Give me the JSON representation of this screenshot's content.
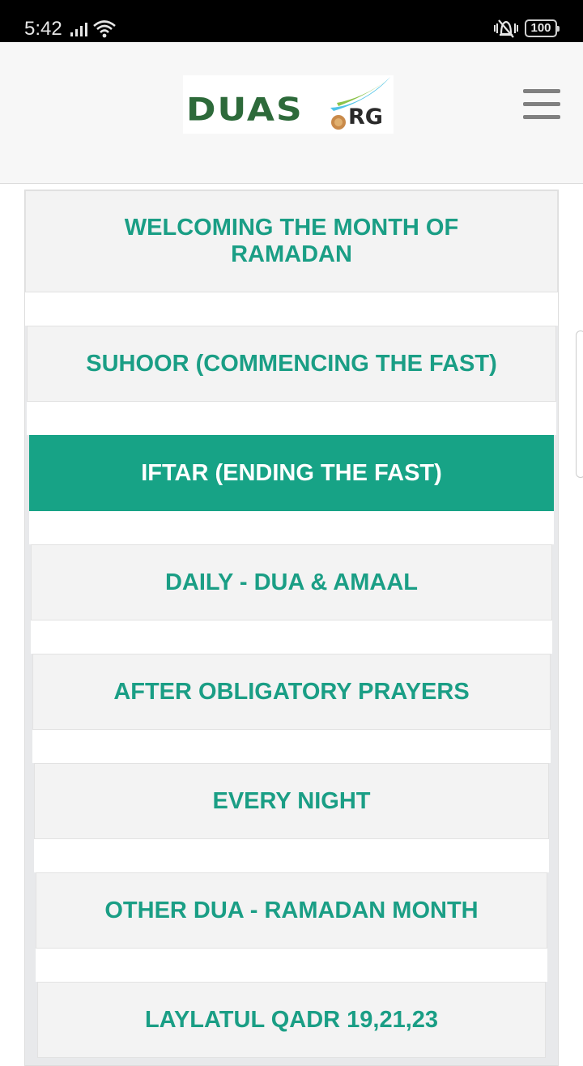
{
  "status_bar": {
    "time": "5:42",
    "battery": "100",
    "icons": [
      "signal-icon",
      "wifi-icon",
      "vibrate-icon",
      "battery-icon"
    ]
  },
  "header": {
    "logo_text": "DUAS",
    "logo_suffix": "RG",
    "menu_icon": "hamburger-menu-icon"
  },
  "menu": {
    "items": [
      {
        "label": "WELCOMING THE MONTH OF RAMADAN",
        "active": false
      },
      {
        "label": "SUHOOR (COMMENCING THE FAST)",
        "active": false
      },
      {
        "label": "IFTAR (ENDING THE FAST)",
        "active": true
      },
      {
        "label": "DAILY - DUA & AMAAL",
        "active": false
      },
      {
        "label": "AFTER OBLIGATORY PRAYERS",
        "active": false
      },
      {
        "label": "EVERY NIGHT",
        "active": false
      },
      {
        "label": "OTHER DUA - RAMADAN MONTH",
        "active": false
      },
      {
        "label": "LAYLATUL QADR 19,21,23",
        "active": false
      }
    ]
  },
  "colors": {
    "accent": "#17a386",
    "item_text": "#1a9e85",
    "item_bg": "#f3f3f3",
    "header_bg": "#f7f7f7"
  }
}
